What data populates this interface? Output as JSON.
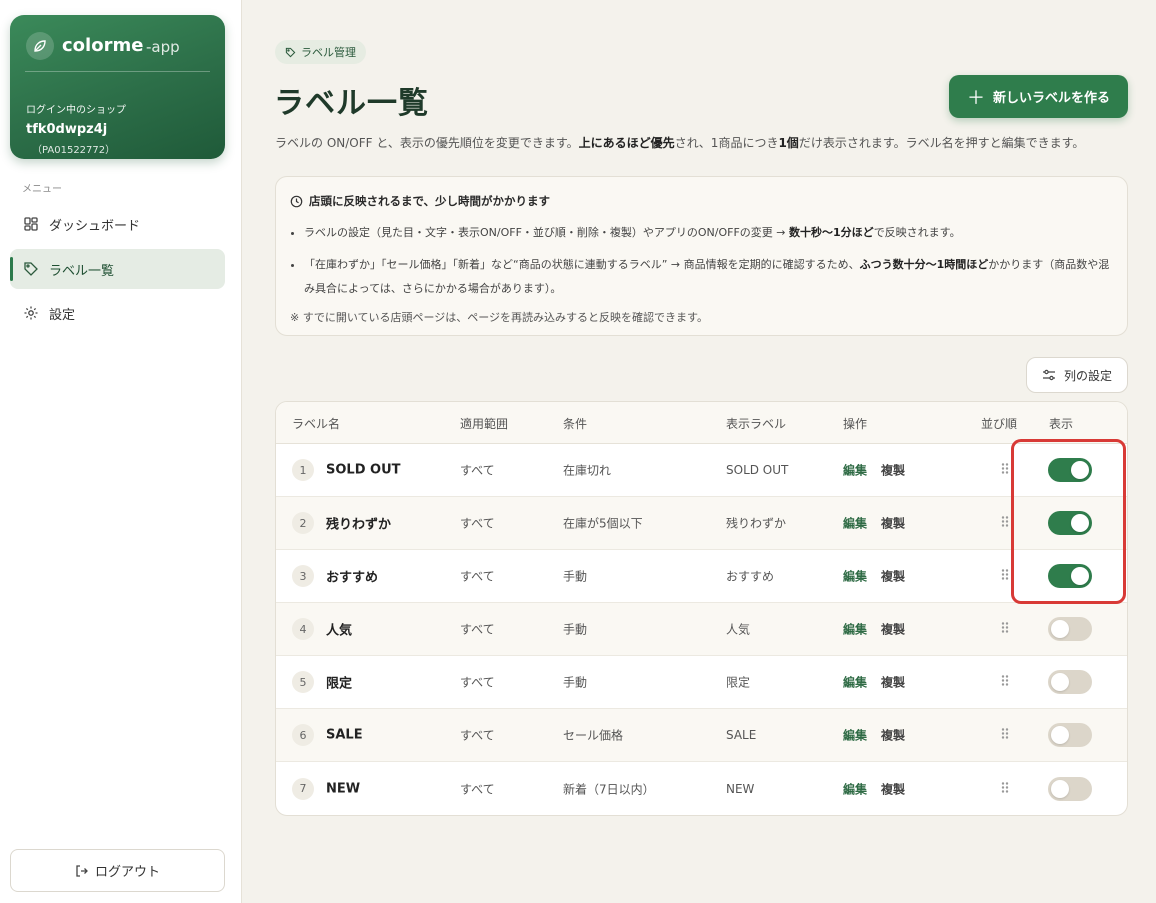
{
  "brand": {
    "name": "colorme",
    "suffix": "-app",
    "shop_caption": "ログイン中のショップ",
    "shop_id": "tfk0dwpz4j",
    "shop_code": "（PA01522772）"
  },
  "sidebar": {
    "menu_caption": "メニュー",
    "items": [
      {
        "label": "ダッシュボード",
        "icon": "dashboard-icon",
        "active": false
      },
      {
        "label": "ラベル一覧",
        "icon": "tag-icon",
        "active": true
      },
      {
        "label": "設定",
        "icon": "gear-icon",
        "active": false
      }
    ],
    "logout_label": "ログアウト"
  },
  "header": {
    "breadcrumb": "ラベル管理",
    "title": "ラベル一覧",
    "new_button": "新しいラベルを作る",
    "desc_part1": "ラベルの ON/OFF と、表示の優先順位を変更できます。",
    "desc_bold1": "上にあるほど優先",
    "desc_part2": "され、1商品につき",
    "desc_bold2": "1個",
    "desc_part3": "だけ表示されます。ラベル名を押すと編集できます。"
  },
  "notice": {
    "title": "店頭に反映されるまで、少し時間がかかります",
    "item1_text": "ラベルの設定（見た目・文字・表示ON/OFF・並び順・削除・複製）やアプリのON/OFFの変更 → ",
    "item1_bold": "数十秒〜1分ほど",
    "item1_tail": "で反映されます。",
    "item2_text": "「在庫わずか」「セール価格」「新着」など“商品の状態に連動するラベル” → 商品情報を定期的に確認するため、",
    "item2_bold": "ふつう数十分〜1時間ほど",
    "item2_tail": "かかります（商品数や混み具合によっては、さらにかかる場合があります）。",
    "note": "※ すでに開いている店頭ページは、ページを再読み込みすると反映を確認できます。"
  },
  "column_settings_label": "列の設定",
  "table": {
    "headers": {
      "name": "ラベル名",
      "scope": "適用範囲",
      "condition": "条件",
      "display": "表示ラベル",
      "actions": "操作",
      "order": "並び順",
      "visible": "表示"
    },
    "edit_label": "編集",
    "duplicate_label": "複製",
    "rows": [
      {
        "index": "1",
        "name": "SOLD OUT",
        "scope": "すべて",
        "condition": "在庫切れ",
        "display": "SOLD OUT",
        "enabled": true
      },
      {
        "index": "2",
        "name": "残りわずか",
        "scope": "すべて",
        "condition": "在庫が5個以下",
        "display": "残りわずか",
        "enabled": true
      },
      {
        "index": "3",
        "name": "おすすめ",
        "scope": "すべて",
        "condition": "手動",
        "display": "おすすめ",
        "enabled": true
      },
      {
        "index": "4",
        "name": "人気",
        "scope": "すべて",
        "condition": "手動",
        "display": "人気",
        "enabled": false
      },
      {
        "index": "5",
        "name": "限定",
        "scope": "すべて",
        "condition": "手動",
        "display": "限定",
        "enabled": false
      },
      {
        "index": "6",
        "name": "SALE",
        "scope": "すべて",
        "condition": "セール価格",
        "display": "SALE",
        "enabled": false
      },
      {
        "index": "7",
        "name": "NEW",
        "scope": "すべて",
        "condition": "新着（7日以内）",
        "display": "NEW",
        "enabled": false
      }
    ]
  },
  "colors": {
    "accent": "#2f7d4c",
    "highlight": "#d83a36",
    "toggle_off": "#dcd6ca"
  }
}
